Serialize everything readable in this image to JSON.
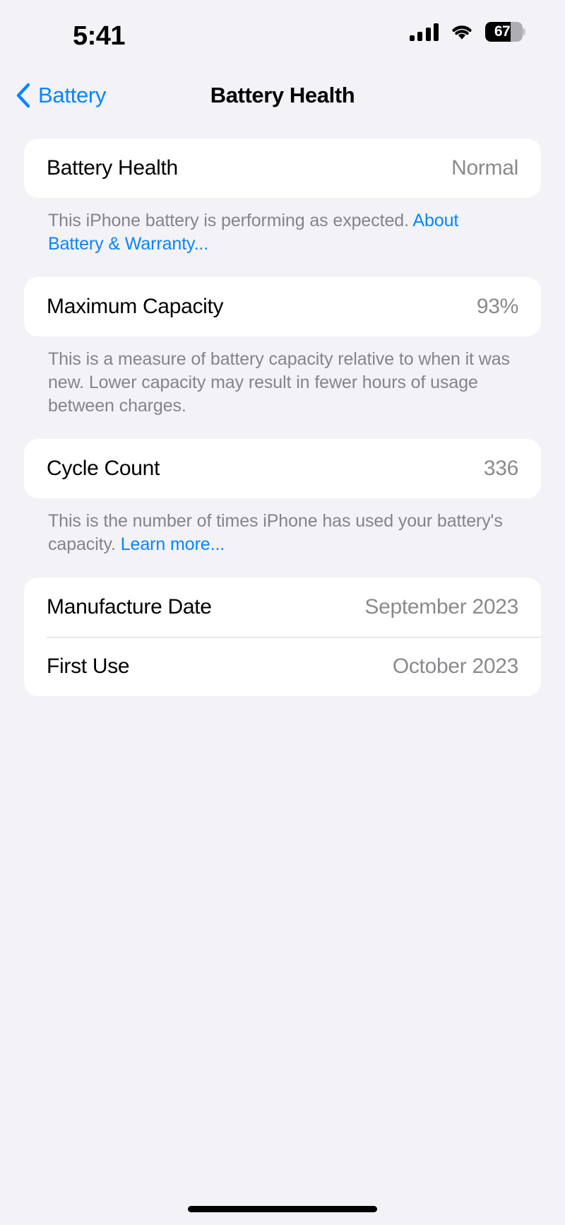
{
  "status_bar": {
    "time": "5:41",
    "cellular_icon": "cellular-signal-icon",
    "wifi_icon": "wifi-icon",
    "battery_icon": "battery-icon",
    "battery_percent": "67",
    "battery_level": 67
  },
  "nav": {
    "back_label": "Battery",
    "back_icon": "chevron-left-icon",
    "title": "Battery Health"
  },
  "sections": [
    {
      "rows": [
        {
          "label": "Battery Health",
          "value": "Normal"
        }
      ],
      "footer": {
        "text": "This iPhone battery is performing as expected. ",
        "link": "About Battery & Warranty..."
      }
    },
    {
      "rows": [
        {
          "label": "Maximum Capacity",
          "value": "93%"
        }
      ],
      "footer": {
        "text": "This is a measure of battery capacity relative to when it was new. Lower capacity may result in fewer hours of usage between charges.",
        "link": ""
      }
    },
    {
      "rows": [
        {
          "label": "Cycle Count",
          "value": "336"
        }
      ],
      "footer": {
        "text": "This is the number of times iPhone has used your battery's capacity. ",
        "link": "Learn more..."
      }
    },
    {
      "rows": [
        {
          "label": "Manufacture Date",
          "value": "September 2023"
        },
        {
          "label": "First Use",
          "value": "October 2023"
        }
      ],
      "footer": {
        "text": "",
        "link": ""
      }
    }
  ],
  "home_indicator": "home-indicator",
  "colors": {
    "accent": "#0a84ff",
    "background": "#f2f2f7",
    "card": "#ffffff",
    "secondary_text": "#858589"
  }
}
